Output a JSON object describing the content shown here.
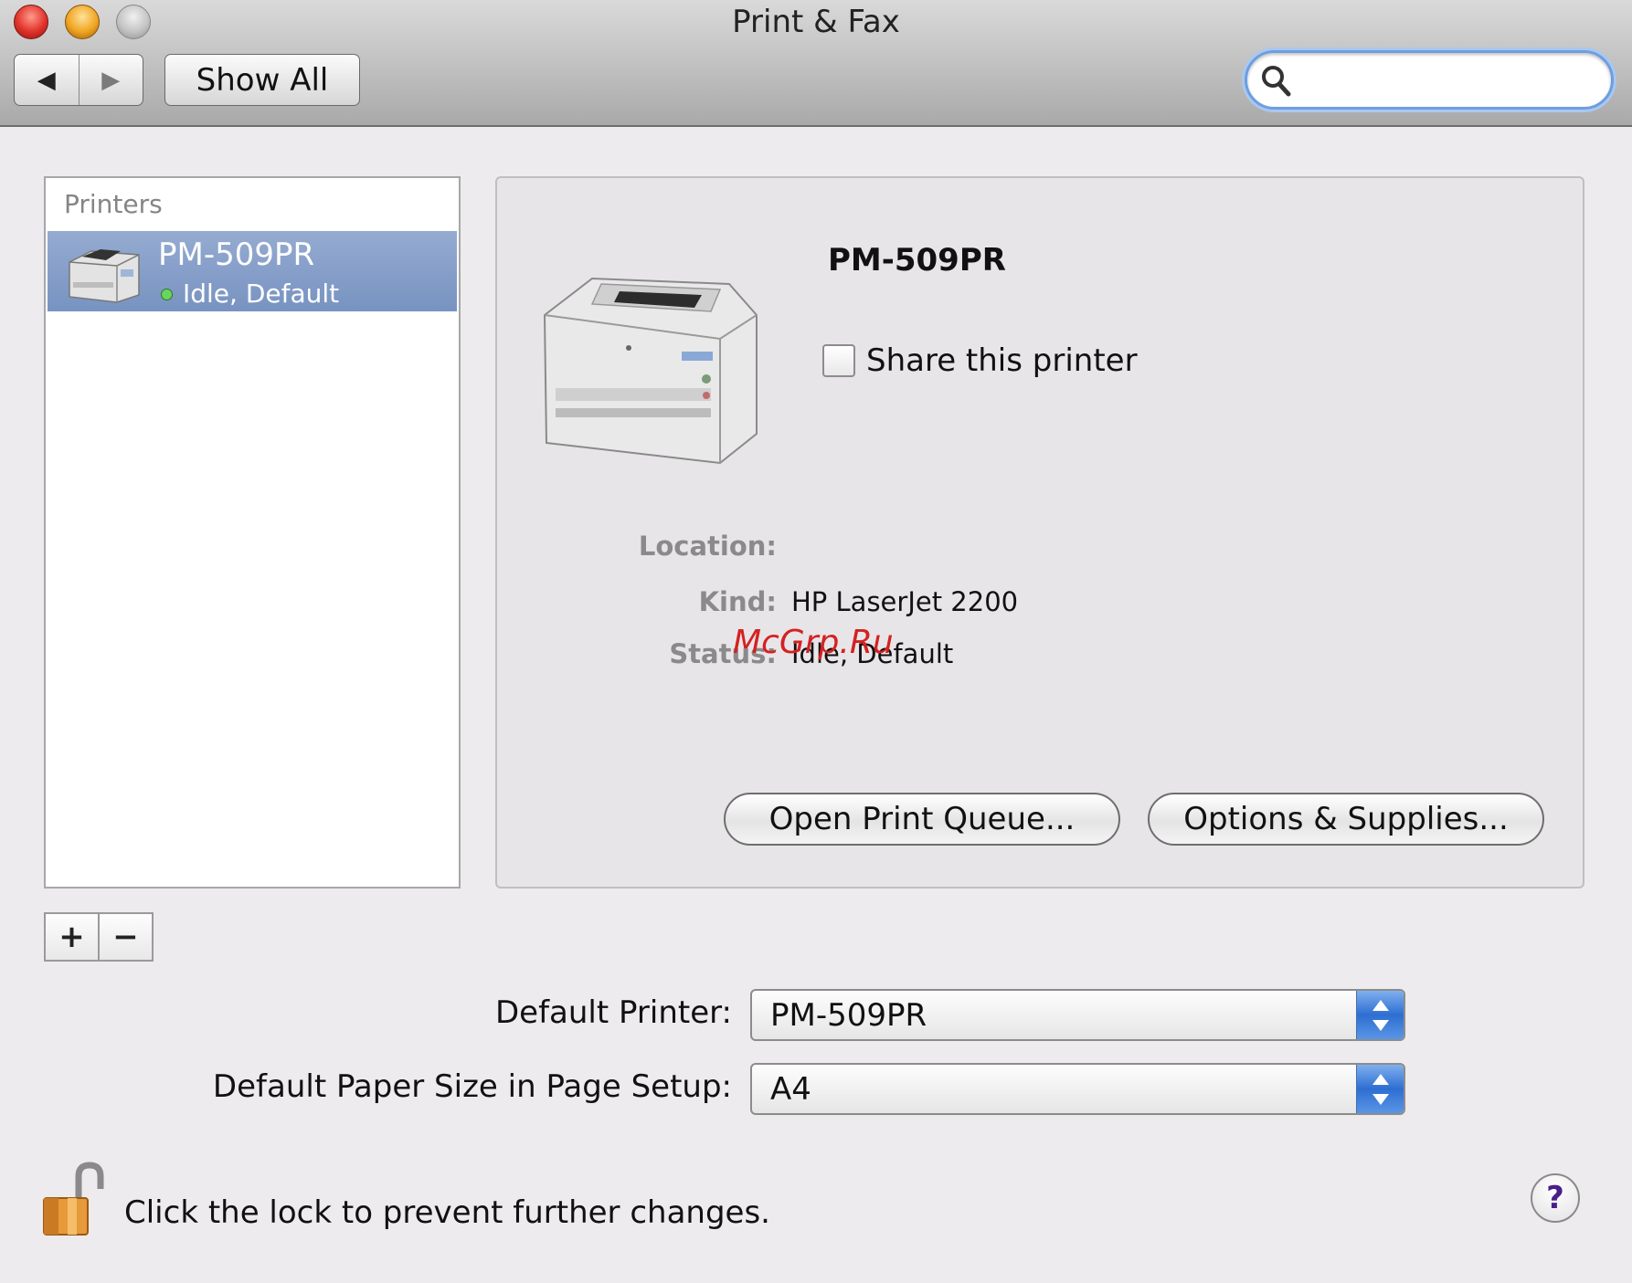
{
  "window": {
    "title": "Print & Fax"
  },
  "toolbar": {
    "back_glyph": "◀",
    "forward_glyph": "▶",
    "show_all_label": "Show All",
    "search_placeholder": "",
    "search_value": ""
  },
  "printers_list": {
    "header": "Printers",
    "items": [
      {
        "name": "PM-509PR",
        "status": "Idle, Default",
        "status_color": "#68d55c",
        "selected": true
      }
    ],
    "add_label": "+",
    "remove_label": "−"
  },
  "detail": {
    "printer_name": "PM-509PR",
    "share_label": "Share this printer",
    "share_checked": false,
    "info": [
      {
        "label": "Location:",
        "value": ""
      },
      {
        "label": "Kind:",
        "value": "HP LaserJet 2200"
      },
      {
        "label": "Status:",
        "value": "Idle, Default"
      }
    ],
    "watermark": "McGrp.Ru",
    "open_queue_label": "Open Print Queue...",
    "options_label": "Options & Supplies..."
  },
  "defaults": {
    "printer_label": "Default Printer:",
    "printer_value": "PM-509PR",
    "paper_label": "Default Paper Size in Page Setup:",
    "paper_value": "A4"
  },
  "footer": {
    "lock_text": "Click the lock to prevent further changes.",
    "help_label": "?"
  },
  "colors": {
    "selection": "#7893c1",
    "popup_accent": "#2e6ed2",
    "search_focus": "#6e9ee0",
    "watermark": "#d42121"
  },
  "icons": [
    "search-icon",
    "printer-icon",
    "unlock-icon",
    "help-icon",
    "popup-arrows-icon",
    "back-arrow-icon",
    "forward-arrow-icon"
  ]
}
